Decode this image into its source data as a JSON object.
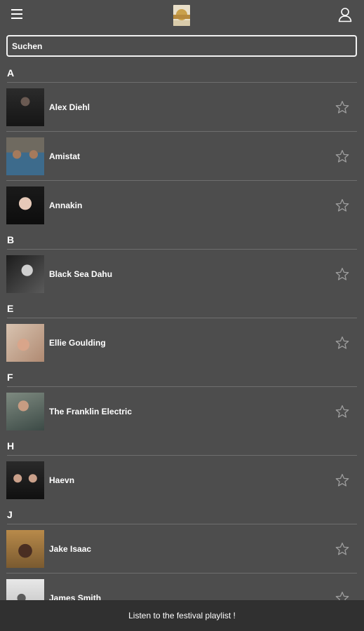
{
  "header": {
    "menu_icon": "hamburger-menu-icon",
    "logo_icon": "festival-logo",
    "profile_icon": "user-profile-icon"
  },
  "search": {
    "placeholder": "Suchen",
    "value": ""
  },
  "sections": [
    {
      "letter": "A",
      "artists": [
        "Alex Diehl",
        "Amistat",
        "Annakin"
      ]
    },
    {
      "letter": "B",
      "artists": [
        "Black Sea Dahu"
      ]
    },
    {
      "letter": "E",
      "artists": [
        "Ellie Goulding"
      ]
    },
    {
      "letter": "F",
      "artists": [
        "The Franklin Electric"
      ]
    },
    {
      "letter": "H",
      "artists": [
        "Haevn"
      ]
    },
    {
      "letter": "J",
      "artists": [
        "Jake Isaac",
        "James Smith"
      ]
    }
  ],
  "favorite_icon": "star-outline-icon",
  "footer": {
    "label": "Listen to the festival playlist !"
  },
  "colors": {
    "background": "#4d4d4d",
    "footer": "#303030",
    "divider": "#6e6e6e",
    "star": "#9e9e9e"
  }
}
